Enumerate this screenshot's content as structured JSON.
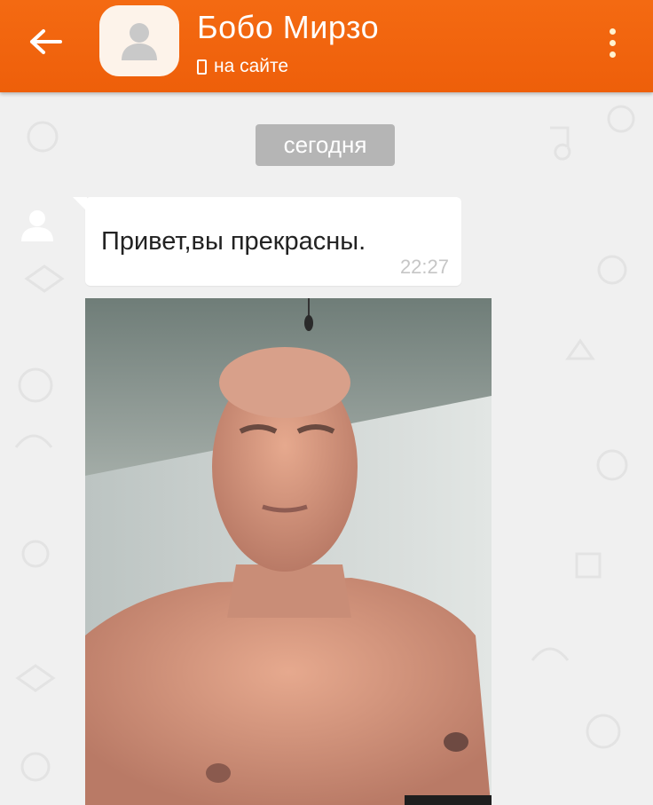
{
  "header": {
    "back_icon": "arrow-left-icon",
    "avatar_icon": "user-placeholder-icon",
    "contact_name": "Бобо Мирзо",
    "status_icon": "mobile-phone-icon",
    "status_text": "на сайте",
    "menu_icon": "more-vertical-icon",
    "background_color": "#f26512"
  },
  "chat": {
    "date_separator": "сегодня",
    "messages": [
      {
        "sender_avatar_icon": "user-placeholder-icon",
        "text": "Привет,вы прекрасны.",
        "time": "22:27"
      },
      {
        "type": "photo",
        "content_icon": "photo-attachment"
      }
    ]
  }
}
